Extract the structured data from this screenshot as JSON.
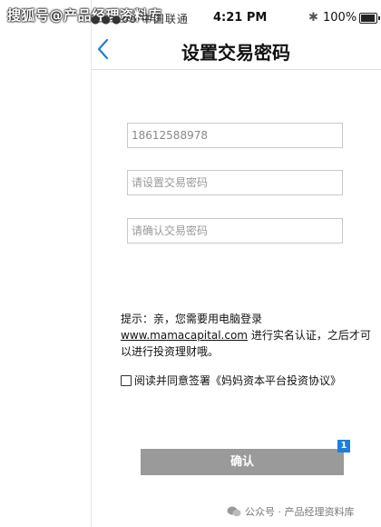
{
  "watermark_top": "搜狐号@产品经理资料库",
  "status_bar": {
    "carrier": "●●●oo 中国联通",
    "time": "4:21 PM",
    "bluetooth": "✱",
    "battery_percent": "100%",
    "battery_level": 1.0
  },
  "nav": {
    "back_icon": "chevron-left-icon",
    "title": "设置交易密码"
  },
  "form": {
    "phone_value": "18612588978",
    "password_placeholder": "请设置交易密码",
    "confirm_placeholder": "请确认交易密码"
  },
  "tip": {
    "prefix": "提示：亲，您需要用电脑登录",
    "link": "www.mamacapital.com",
    "suffix": "进行实名认证，之后才可以进行投资理财哦。"
  },
  "agreement": {
    "text": "阅读并同意签署《妈妈资本平台投资协议》"
  },
  "confirm_button": {
    "label": "确认",
    "badge": "1"
  },
  "watermark_bottom": "公众号 · 产品经理资料库",
  "colors": {
    "accent": "#1e7fd6",
    "button_bg": "#9a9a9a"
  }
}
